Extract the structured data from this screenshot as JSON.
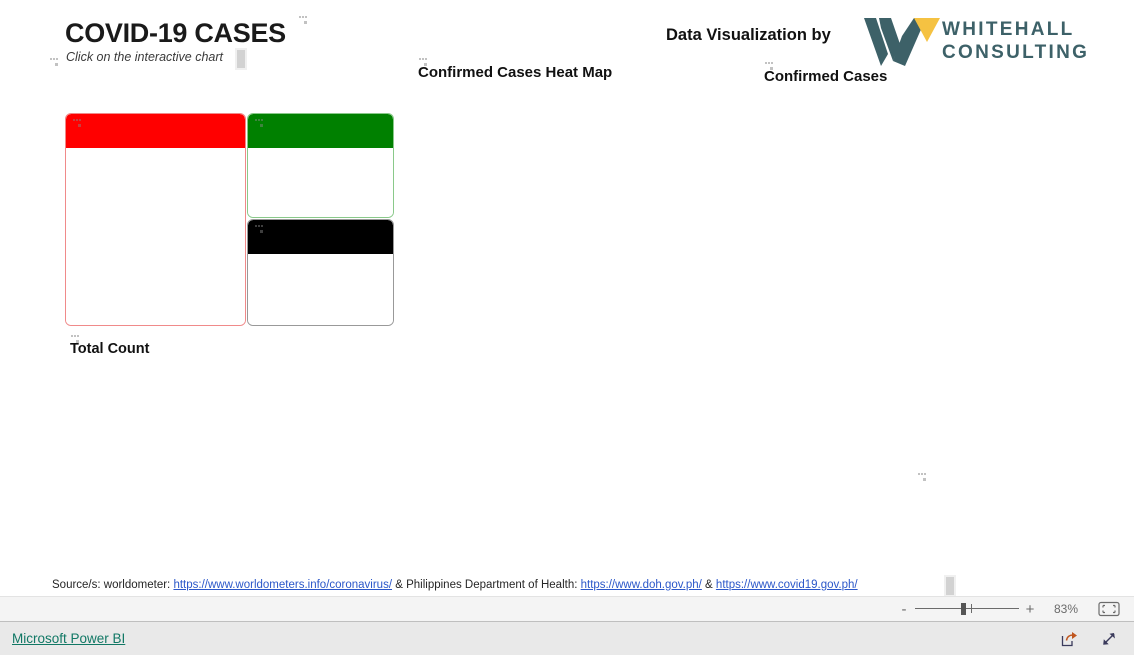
{
  "report": {
    "title": "COVID-19 CASES",
    "subtitle": "Click on the interactive chart",
    "viz_by_label": "Data Visualization by",
    "brand": {
      "wordmark_line1": "WHITEHALL",
      "wordmark_line2": "CONSULTING",
      "mark_color": "#3d6168",
      "accent_color": "#f5c242"
    },
    "visuals": [
      {
        "name": "total-count",
        "title": "Total Count",
        "header_color": "#ff0000",
        "state": "loading"
      },
      {
        "name": "confirmed-cases-heat-map",
        "title": "Confirmed Cases Heat Map",
        "header_color": "#008000",
        "state": "loading"
      },
      {
        "name": "confirmed-cases",
        "title": "Confirmed Cases",
        "header_color": "#000000",
        "state": "loading"
      }
    ],
    "source_footer": {
      "prefix": "Source/s: worldometer: ",
      "link1": "https://www.worldometers.info/coronavirus/",
      "middle": " & Philippines Department of Health: ",
      "link2": "https://www.doh.gov.ph/",
      "separator": " & ",
      "link3": "https://www.covid19.gov.ph/"
    }
  },
  "zoom_toolbar": {
    "zoom_out_label": "-",
    "zoom_in_label": "+",
    "zoom_level": "83%",
    "fit_to_page_icon": "fit-to-page-icon"
  },
  "status_bar": {
    "powerbi_label": "Microsoft Power BI",
    "share_icon": "share-icon",
    "fullscreen_icon": "fullscreen-icon"
  }
}
